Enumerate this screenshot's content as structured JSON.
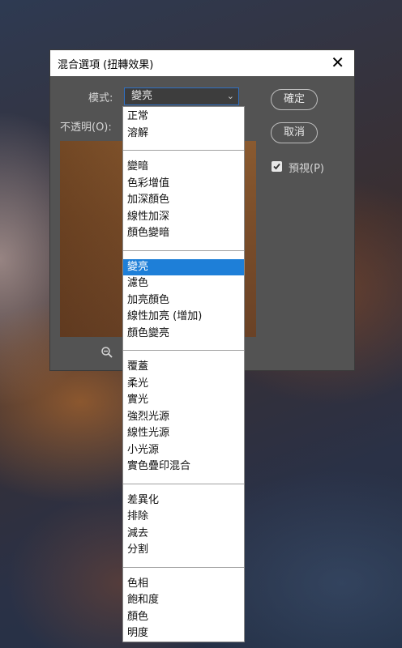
{
  "dialog": {
    "title": "混合選項 (扭轉效果)",
    "mode_label": "模式:",
    "mode_value": "變亮",
    "opacity_label": "不透明(O):",
    "ok_label": "確定",
    "cancel_label": "取消",
    "preview_label": "預視(P)",
    "preview_checked": true
  },
  "dropdown": {
    "groups": [
      [
        "正常",
        "溶解"
      ],
      [
        "變暗",
        "色彩增值",
        "加深顏色",
        "線性加深",
        "顏色變暗"
      ],
      [
        "變亮",
        "濾色",
        "加亮顏色",
        "線性加亮 (增加)",
        "顏色變亮"
      ],
      [
        "覆蓋",
        "柔光",
        "實光",
        "強烈光源",
        "線性光源",
        "小光源",
        "實色疊印混合"
      ],
      [
        "差異化",
        "排除",
        "減去",
        "分割"
      ],
      [
        "色相",
        "飽和度",
        "顏色",
        "明度"
      ]
    ],
    "selected": "變亮"
  },
  "colors": {
    "dialog_bg": "#535353",
    "highlight": "#1e7fd8",
    "select_border": "#2f6fc1"
  }
}
